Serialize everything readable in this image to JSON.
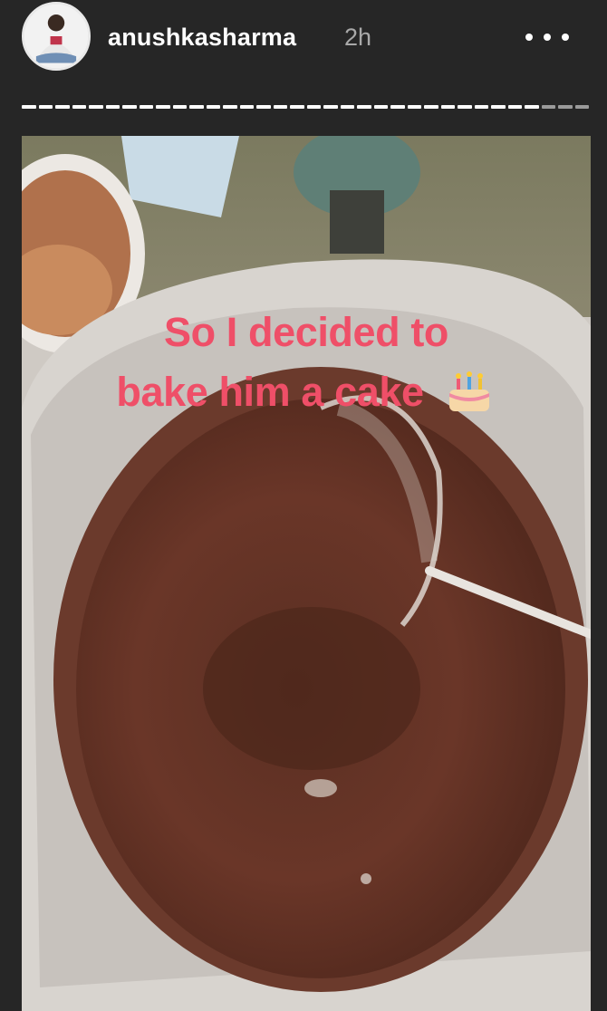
{
  "header": {
    "username": "anushkasharma",
    "timestamp": "2h",
    "avatar_icon": "profile-avatar",
    "more_icon": "more-options-icon"
  },
  "progress": {
    "segments_total": 34,
    "segments_seen": 31
  },
  "story": {
    "caption_line1": "So I decided to",
    "caption_line2": "bake him a cake",
    "sticker": "birthday-cake-emoji",
    "caption_color": "#ef4f68"
  }
}
